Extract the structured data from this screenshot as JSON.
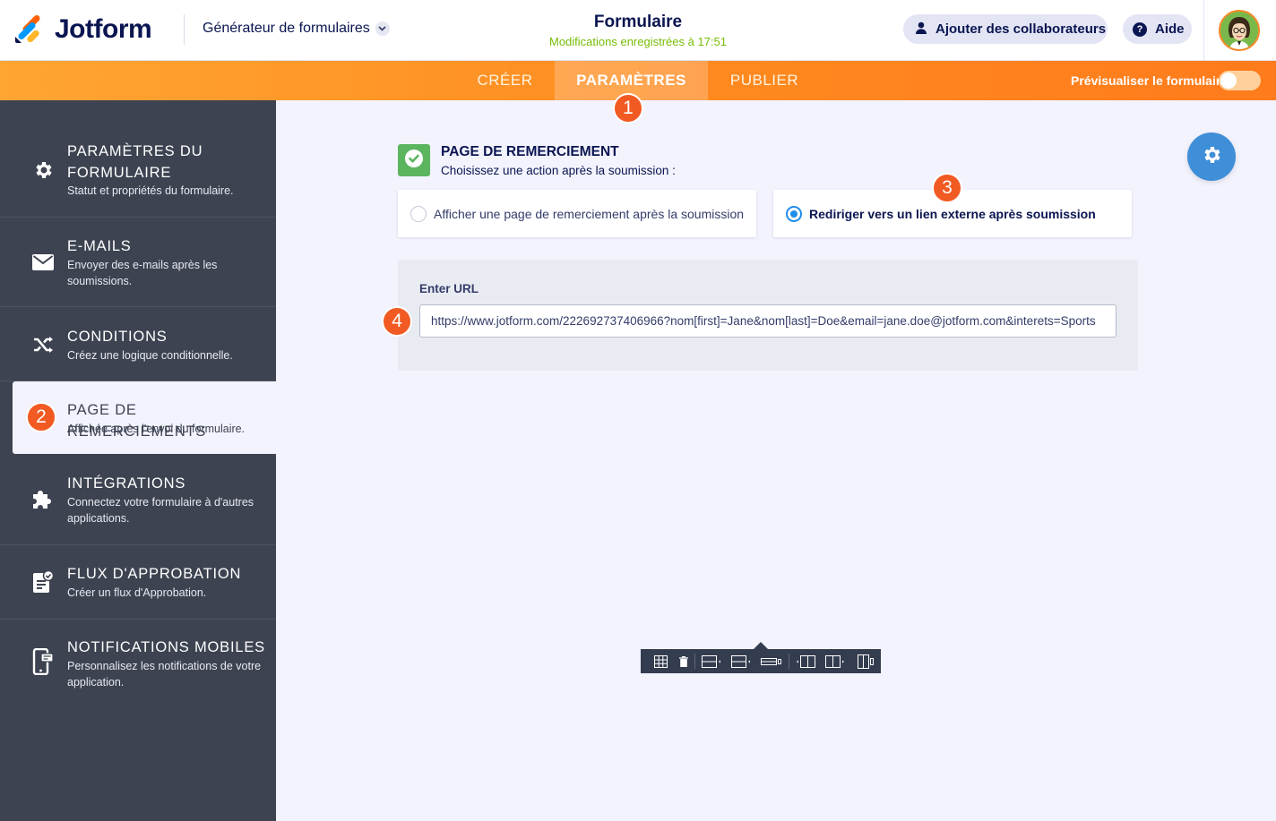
{
  "header": {
    "logo_text": "Jotform",
    "builder_label": "Générateur de formulaires",
    "form_title": "Formulaire",
    "save_status": "Modifications enregistrées à 17:51",
    "collab_label": "Ajouter des collaborateurs",
    "help_label": "Aide"
  },
  "nav": {
    "tabs": [
      {
        "label": "CRÉER",
        "active": false
      },
      {
        "label": "PARAMÈTRES",
        "active": true
      },
      {
        "label": "PUBLIER",
        "active": false
      }
    ],
    "preview_label": "Prévisualiser le formulaire",
    "preview_on": false
  },
  "badges": [
    "1",
    "2",
    "3",
    "4"
  ],
  "sidebar": {
    "items": [
      {
        "title_line1": "PARAMÈTRES DU",
        "title_line2": "FORMULAIRE",
        "desc": "Statut et propriétés du formulaire.",
        "icon": "gear-icon"
      },
      {
        "title": "E-MAILS",
        "desc_line1": "Envoyer des e-mails après les",
        "desc_line2": "soumissions.",
        "icon": "envelope-icon"
      },
      {
        "title": "CONDITIONS",
        "desc": "Créez une logique conditionnelle.",
        "icon": "shuffle-icon"
      },
      {
        "title": "PAGE DE REMERCIEMENTS",
        "desc": "Affichée après l'envoi du formulaire.",
        "active": true
      },
      {
        "title": "INTÉGRATIONS",
        "desc_line1": "Connectez votre formulaire à d'autres",
        "desc_line2": "applications.",
        "icon": "puzzle-icon"
      },
      {
        "title": "FLUX D'APPROBATION",
        "desc": "Créer un flux d'Approbation.",
        "icon": "approval-icon"
      },
      {
        "title": "NOTIFICATIONS MOBILES",
        "desc_line1": "Personnalisez les notifications de votre",
        "desc_line2": "application.",
        "icon": "mobile-notification-icon"
      }
    ]
  },
  "main": {
    "section_title": "PAGE DE REMERCIEMENT",
    "section_subtitle": "Choisissez une action après la soumission :",
    "options": [
      {
        "label": "Afficher une page de remerciement après la soumission",
        "checked": false
      },
      {
        "label": "Rediriger vers un lien externe après soumission",
        "checked": true
      }
    ],
    "url_label": "Enter URL",
    "url_value": "https://www.jotform.com/222692737406966?nom[first]=Jane&nom[last]=Doe&email=jane.doe@jotform.com&interets=Sports"
  },
  "colors": {
    "accent_orange": "#ff8a1f",
    "badge": "#f15a22",
    "sidebar_bg": "#3d4351",
    "primary_blue": "#3e8ed8",
    "success_green": "#5bb55f",
    "save_status_green": "#78bb07"
  }
}
